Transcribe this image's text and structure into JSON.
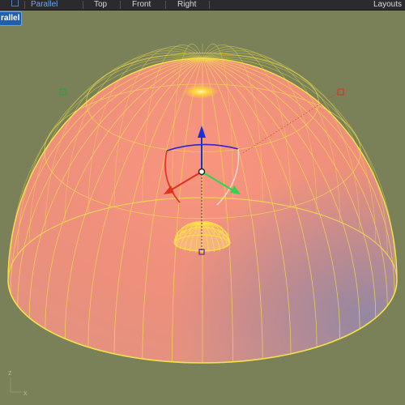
{
  "tabbar": {
    "tabs": [
      {
        "label": "Parallel",
        "active": true
      },
      {
        "label": "Top",
        "active": false
      },
      {
        "label": "Front",
        "active": false
      },
      {
        "label": "Right",
        "active": false
      }
    ],
    "layouts_label": "Layouts"
  },
  "viewport": {
    "name_label": "rallel",
    "axis_x": "x",
    "axis_z": "z"
  },
  "colors": {
    "background": "#7a8158",
    "wireframe": "#f4e24a",
    "dome_fill": "#f6917f",
    "highlight": "#fff7b0",
    "gizmo_z": "#1c2ed8",
    "gizmo_x": "#e0301f",
    "gizmo_y": "#2bd84a",
    "control_point": "#2ea03a",
    "accent_tab": "#6aa6ee"
  }
}
